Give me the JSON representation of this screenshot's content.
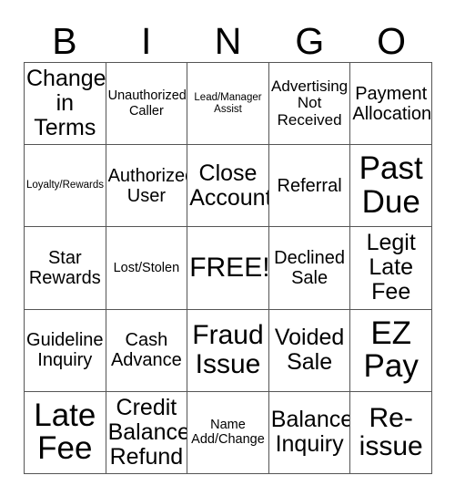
{
  "card": {
    "title": "BINGO",
    "columns": [
      "B",
      "I",
      "N",
      "G",
      "O"
    ],
    "free_space_index": 12,
    "colors": {
      "background": "#ffffff",
      "text": "#000000",
      "border": "#555555"
    },
    "rows": [
      [
        {
          "label": "Change\nin\nTerms",
          "size": "l"
        },
        {
          "label": "Unauthorized\nCaller",
          "size": "xs"
        },
        {
          "label": "Lead/Manager\nAssist",
          "size": "xxs"
        },
        {
          "label": "Advertising\nNot\nReceived",
          "size": "s"
        },
        {
          "label": "Payment\nAllocation",
          "size": "m"
        }
      ],
      [
        {
          "label": "Loyalty/Rewards",
          "size": "xxs"
        },
        {
          "label": "Authorized\nUser",
          "size": "m"
        },
        {
          "label": "Close\nAccount",
          "size": "l"
        },
        {
          "label": "Referral",
          "size": "m"
        },
        {
          "label": "Past\nDue",
          "size": "xxl"
        }
      ],
      [
        {
          "label": "Star\nRewards",
          "size": "m"
        },
        {
          "label": "Lost/Stolen",
          "size": "xs"
        },
        {
          "label": "FREE!",
          "size": "xl"
        },
        {
          "label": "Declined\nSale",
          "size": "m"
        },
        {
          "label": "Legit\nLate\nFee",
          "size": "l"
        }
      ],
      [
        {
          "label": "Guideline\nInquiry",
          "size": "m"
        },
        {
          "label": "Cash\nAdvance",
          "size": "m"
        },
        {
          "label": "Fraud\nIssue",
          "size": "xl"
        },
        {
          "label": "Voided\nSale",
          "size": "l"
        },
        {
          "label": "EZ\nPay",
          "size": "xxl"
        }
      ],
      [
        {
          "label": "Late\nFee",
          "size": "xxl"
        },
        {
          "label": "Credit\nBalance\nRefund",
          "size": "l"
        },
        {
          "label": "Name\nAdd/Change",
          "size": "xs"
        },
        {
          "label": "Balance\nInquiry",
          "size": "l"
        },
        {
          "label": "Re-\nissue",
          "size": "xl"
        }
      ]
    ]
  }
}
